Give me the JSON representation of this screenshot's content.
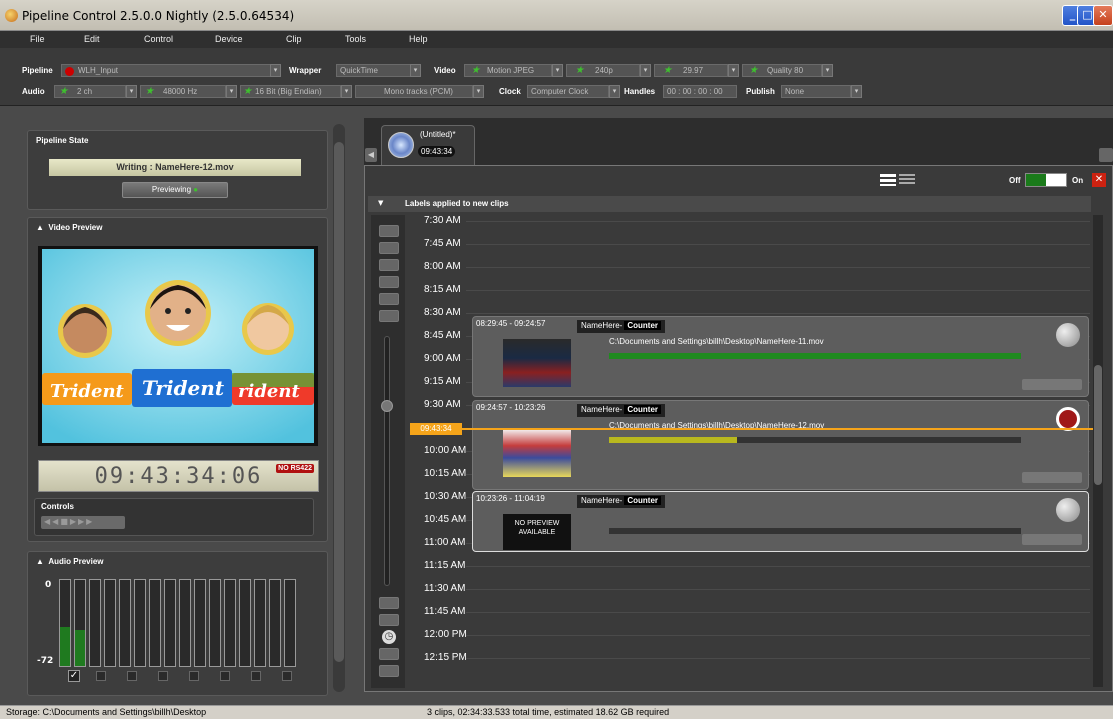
{
  "window": {
    "title": "Pipeline Control 2.5.0.0 Nightly (2.5.0.64534)"
  },
  "menu": [
    "File",
    "Edit",
    "Control",
    "Device",
    "Clip",
    "Tools",
    "Help"
  ],
  "toolbar": {
    "pipeline_label": "Pipeline",
    "pipeline_value": "WLH_Input",
    "wrapper_label": "Wrapper",
    "wrapper_value": "QuickTime",
    "video_label": "Video",
    "video_codec": "Motion JPEG",
    "video_size": "240p",
    "video_fps": "29.97",
    "video_quality": "Quality 80",
    "audio_label": "Audio",
    "audio_channels": "2  ch",
    "audio_rate": "48000  Hz",
    "audio_bits": "16 Bit (Big Endian)",
    "audio_tracks": "Mono tracks (PCM)",
    "clock_label": "Clock",
    "clock_value": "Computer Clock",
    "handles_label": "Handles",
    "handles_value": "00 : 00 : 00 : 00",
    "publish_label": "Publish",
    "publish_value": "None"
  },
  "left": {
    "pipeline_state_title": "Pipeline State",
    "writing_text": "Writing : NameHere-12.mov",
    "previewing_label": "Previewing",
    "video_preview_title": "Video Preview",
    "timecode": "09:43:34:06",
    "no_rs422": "NO RS422",
    "controls_title": "Controls",
    "audio_preview_title": "Audio Preview",
    "meter_top": "0",
    "meter_bottom": "-72",
    "meter_levels": [
      0.45,
      0.42,
      0,
      0,
      0,
      0,
      0,
      0,
      0,
      0,
      0,
      0,
      0,
      0,
      0,
      0
    ]
  },
  "tab": {
    "title": "(Untitled)*",
    "time": "09:43:34"
  },
  "panel": {
    "off_label": "Off",
    "on_label": "On",
    "labels_header": "Labels applied to new clips",
    "current_time": "09:43:34"
  },
  "times": [
    "7:30 AM",
    "7:45 AM",
    "8:00 AM",
    "8:15 AM",
    "8:30 AM",
    "8:45 AM",
    "9:00 AM",
    "9:15 AM",
    "9:30 AM",
    "9:45 AM",
    "10:00 AM",
    "10:15 AM",
    "10:30 AM",
    "10:45 AM",
    "11:00 AM",
    "11:15 AM",
    "11:30 AM",
    "11:45 AM",
    "12:00 PM",
    "12:15 PM"
  ],
  "clips": [
    {
      "range": "08:29:45  -  09:24:57",
      "name": "NameHere-",
      "counter": "Counter",
      "path": "C:\\Documents and Settings\\billh\\Desktop\\NameHere-11.mov",
      "progress": 1.0,
      "color": "#1f8a1f"
    },
    {
      "range": "09:24:57  -  10:23:26",
      "name": "NameHere-",
      "counter": "Counter",
      "path": "C:\\Documents and Settings\\billh\\Desktop\\NameHere-12.mov",
      "progress": 0.31,
      "color": "#b8b81e"
    },
    {
      "range": "10:23:26  -  11:04:19",
      "name": "NameHere-",
      "counter": "Counter",
      "path": "",
      "progress": 0,
      "color": "#333333",
      "thumb_text": "NO PREVIEW AVAILABLE"
    }
  ],
  "status": {
    "storage": "Storage: C:\\Documents and Settings\\billh\\Desktop",
    "summary": "3 clips, 02:34:33.533 total time, estimated 18.62 GB required"
  }
}
